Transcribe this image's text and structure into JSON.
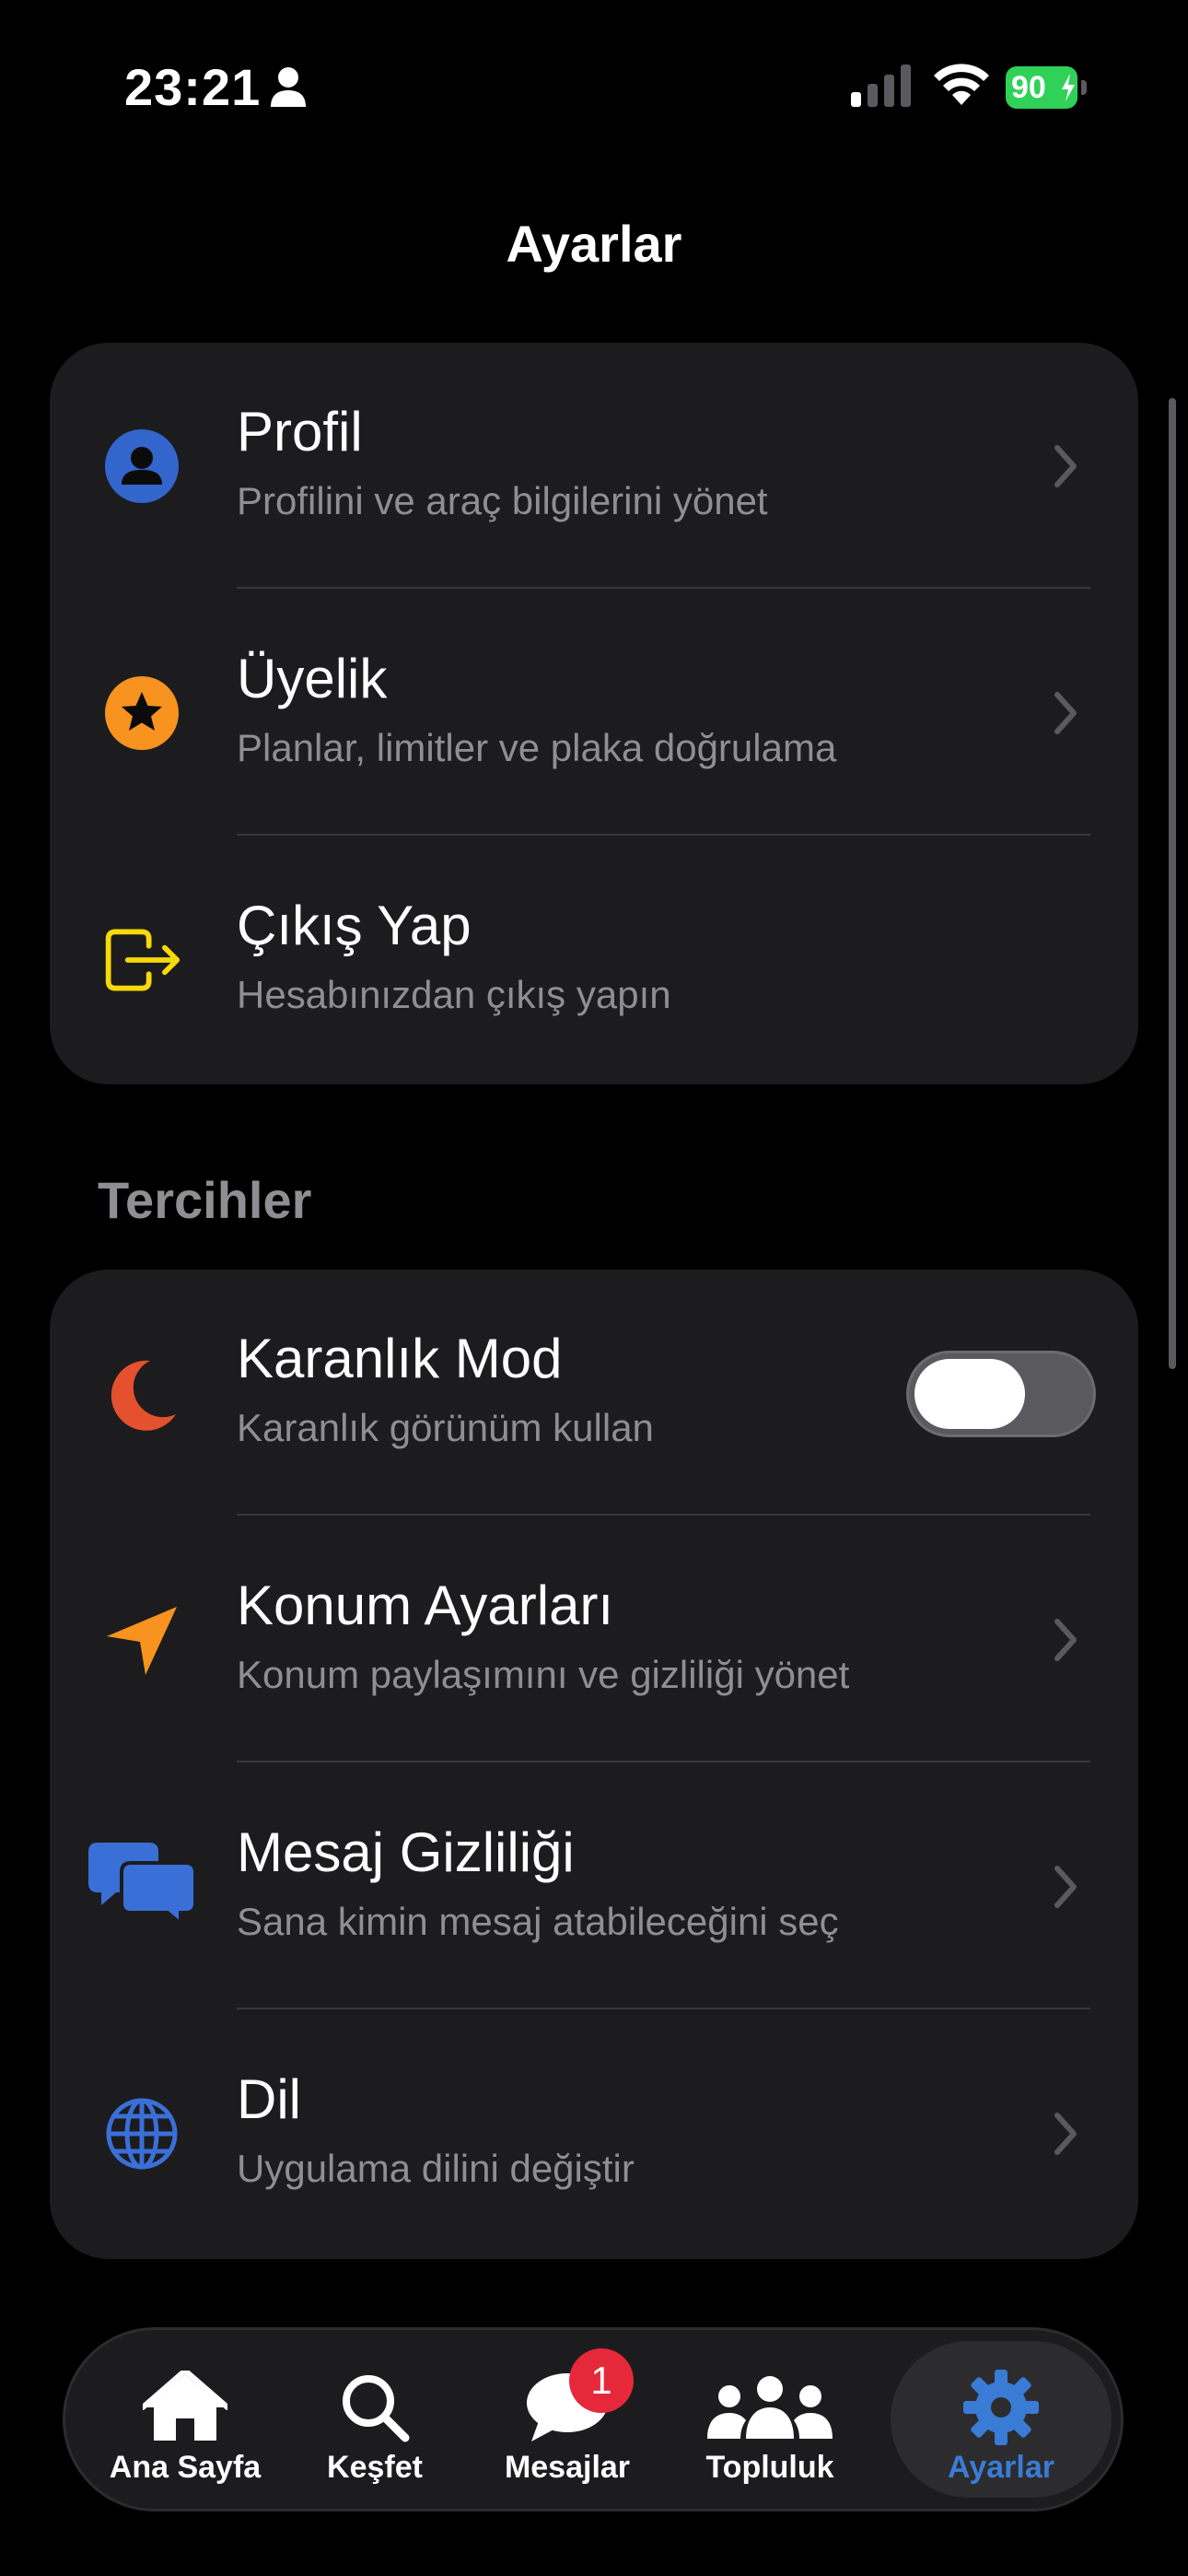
{
  "status_bar": {
    "time": "23:21",
    "battery": "90"
  },
  "page": {
    "title": "Ayarlar"
  },
  "account_section": {
    "items": [
      {
        "title": "Profil",
        "subtitle": "Profilini ve araç bilgilerini yönet",
        "icon": "person-circle-icon",
        "color": "#3366cc"
      },
      {
        "title": "Üyelik",
        "subtitle": "Planlar, limitler ve plaka doğrulama",
        "icon": "star-circle-icon",
        "color": "#f7931e"
      },
      {
        "title": "Çıkış Yap",
        "subtitle": "Hesabınızdan çıkış yapın",
        "icon": "logout-icon",
        "color": "#f5d90a"
      }
    ]
  },
  "preferences_section": {
    "header": "Tercihler",
    "items": [
      {
        "title": "Karanlık Mod",
        "subtitle": "Karanlık görünüm kullan",
        "icon": "moon-icon",
        "color": "#e5502e",
        "toggle_on": false
      },
      {
        "title": "Konum Ayarları",
        "subtitle": "Konum paylaşımını ve gizliliği yönet",
        "icon": "location-arrow-icon",
        "color": "#f7931e"
      },
      {
        "title": "Mesaj Gizliliği",
        "subtitle": "Sana kimin mesaj atabileceğini seç",
        "icon": "chat-bubbles-icon",
        "color": "#3a6fd8"
      },
      {
        "title": "Dil",
        "subtitle": "Uygulama dilini değiştir",
        "icon": "globe-icon",
        "color": "#3a6fd8"
      }
    ]
  },
  "tab_bar": {
    "tabs": [
      {
        "label": "Ana Sayfa",
        "icon": "home-icon"
      },
      {
        "label": "Keşfet",
        "icon": "search-icon"
      },
      {
        "label": "Mesajlar",
        "icon": "chat-bubble-icon",
        "badge": "1"
      },
      {
        "label": "Topluluk",
        "icon": "people-icon"
      },
      {
        "label": "Ayarlar",
        "icon": "gear-icon",
        "active": true
      }
    ],
    "active_color": "#3a7bd5",
    "badge_color": "#e5293b"
  }
}
